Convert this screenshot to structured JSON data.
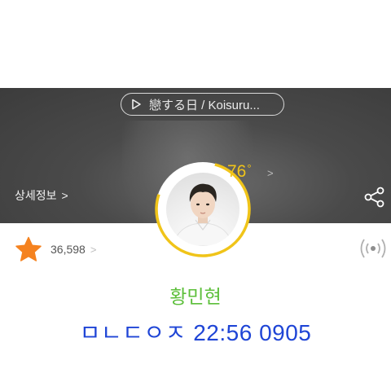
{
  "banner": {
    "song_title": "戀する日 / Koisuru...",
    "detail_link": "상세정보",
    "detail_chevron": ">"
  },
  "profile": {
    "temperature": "76",
    "degree_symbol": "°",
    "temperature_chevron": ">",
    "accent_color": "#f0c419",
    "name": "황민현",
    "name_color": "#5cbf3a"
  },
  "stats": {
    "like_count": "36,598",
    "like_chevron": ">",
    "star_color": "#f5821f"
  },
  "caption": {
    "text": "ㅁㄴㄷㅇㅈ 22:56 0905",
    "color": "#1f45d6"
  },
  "icons": {
    "play": "play-icon",
    "share": "share-icon",
    "star": "star-icon",
    "live": "live-broadcast-icon"
  }
}
